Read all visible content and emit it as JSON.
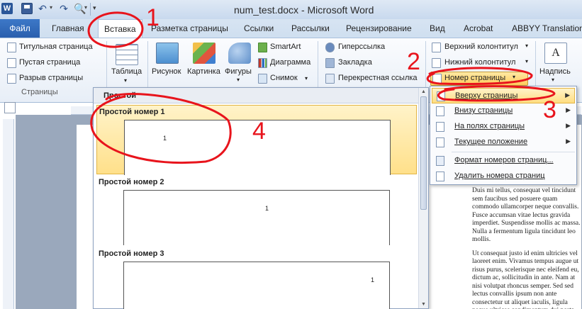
{
  "window": {
    "title": "num_test.docx - Microsoft Word",
    "logo_letter": "W"
  },
  "tabs": [
    "Файл",
    "Главная",
    "Вставка",
    "Разметка страницы",
    "Ссылки",
    "Рассылки",
    "Рецензирование",
    "Вид",
    "Acrobat",
    "ABBYY Translation"
  ],
  "ribbon": {
    "pages_group": {
      "items": [
        "Титульная страница",
        "Пустая страница",
        "Разрыв страницы"
      ],
      "label": "Страницы"
    },
    "table_label": "Таблица",
    "illustrations": {
      "picture": "Рисунок",
      "clip_art": "Картинка",
      "shapes": "Фигуры",
      "smartart": "SmartArt",
      "chart": "Диаграмма",
      "screenshot": "Снимок"
    },
    "links": {
      "hyperlink": "Гиперссылка",
      "bookmark": "Закладка",
      "cross_ref": "Перекрестная ссылка"
    },
    "header_footer": {
      "header": "Верхний колонтитул",
      "footer": "Нижний колонтитул",
      "page_number": "Номер страницы"
    },
    "text_box": "Надпись"
  },
  "gallery": {
    "header": "Простой",
    "items": [
      {
        "title": "Простой номер 1",
        "num": "1"
      },
      {
        "title": "Простой номер 2",
        "num": "1"
      },
      {
        "title": "Простой номер 3",
        "num": "1"
      }
    ]
  },
  "submenu": {
    "items": [
      "Вверху страницы",
      "Внизу страницы",
      "На полях страницы",
      "Текущее положение",
      "Формат номеров страниц...",
      "Удалить номера страниц"
    ]
  },
  "document_text": {
    "p1": "Duis mi tellus, consequat vel tincidunt sem faucibus sed posuere quam commodo ullamcorper neque convallis. Fusce accumsan vitae lectus gravida imperdiet. Suspendisse mollis ac massa. Nulla a fermentum ligula tincidunt leo mollis.",
    "p2": "Ut consequat justo id enim ultricies vel laoreet enim. Vivamus tempus augue ut risus purus, scelerisque nec eleifend eu, dictum ac, sollicitudin in ante. Nam at nisi volutpat rhoncus semper. Sed sed lectus convallis ipsum non ante consectetur ut aliquet iaculis, ligula neque ultrices condimentum dui porta ultrices. Aenean"
  },
  "annotations": {
    "n1": "1",
    "n2": "2",
    "n3": "3",
    "n4": "4",
    "color": "#e8141c"
  },
  "colors": {
    "file_tab": "#2a5fae",
    "highlight": "#ffd96b"
  }
}
